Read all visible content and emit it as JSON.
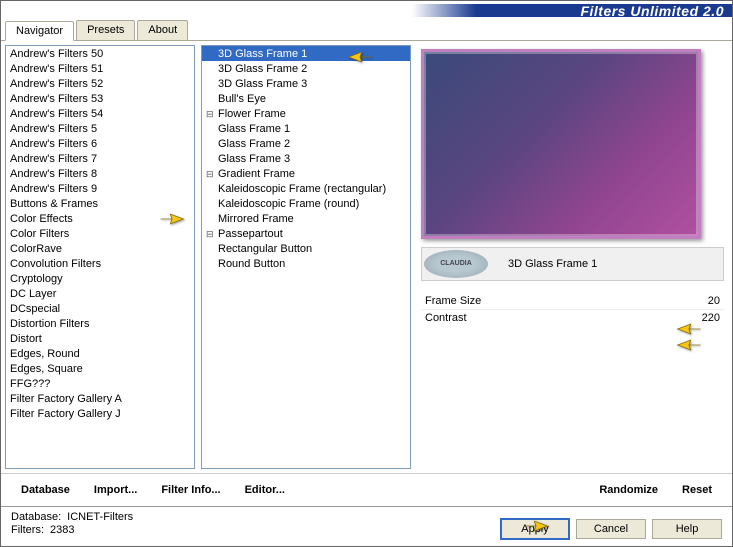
{
  "title": "Filters Unlimited 2.0",
  "tabs": [
    "Navigator",
    "Presets",
    "About"
  ],
  "active_tab": 0,
  "categories": [
    "Andrew's Filters 50",
    "Andrew's Filters 51",
    "Andrew's Filters 52",
    "Andrew's Filters 53",
    "Andrew's Filters 54",
    "Andrew's Filters 5",
    "Andrew's Filters 6",
    "Andrew's Filters 7",
    "Andrew's Filters 8",
    "Andrew's Filters 9",
    "Buttons & Frames",
    "Color Effects",
    "Color Filters",
    "ColorRave",
    "Convolution Filters",
    "Cryptology",
    "DC Layer",
    "DCspecial",
    "Distortion Filters",
    "Distort",
    "Edges, Round",
    "Edges, Square",
    "FFG???",
    "Filter Factory Gallery A",
    "Filter Factory Gallery J"
  ],
  "selected_category": "Buttons & Frames",
  "filters": [
    {
      "label": "3D Glass Frame 1",
      "group": false,
      "selected": true
    },
    {
      "label": "3D Glass Frame 2",
      "group": false
    },
    {
      "label": "3D Glass Frame 3",
      "group": false
    },
    {
      "label": "Bull's Eye",
      "group": false
    },
    {
      "label": "Flower Frame",
      "group": true
    },
    {
      "label": "Glass Frame 1",
      "group": false
    },
    {
      "label": "Glass Frame 2",
      "group": false
    },
    {
      "label": "Glass Frame 3",
      "group": false
    },
    {
      "label": "Gradient Frame",
      "group": true
    },
    {
      "label": "Kaleidoscopic Frame (rectangular)",
      "group": false
    },
    {
      "label": "Kaleidoscopic Frame (round)",
      "group": false
    },
    {
      "label": "Mirrored Frame",
      "group": false
    },
    {
      "label": "Passepartout",
      "group": true
    },
    {
      "label": "Rectangular Button",
      "group": false
    },
    {
      "label": "Round Button",
      "group": false
    }
  ],
  "current_filter": "3D Glass Frame 1",
  "logo_text": "CLAUDIA",
  "params": [
    {
      "name": "Frame Size",
      "value": "20"
    },
    {
      "name": "Contrast",
      "value": "220"
    }
  ],
  "bottom_buttons": {
    "database": "Database",
    "import": "Import...",
    "filter_info": "Filter Info...",
    "editor": "Editor...",
    "randomize": "Randomize",
    "reset": "Reset"
  },
  "status": {
    "db_label": "Database:",
    "db_value": "ICNET-Filters",
    "filters_label": "Filters:",
    "filters_value": "2383"
  },
  "dialog": {
    "apply": "Apply",
    "cancel": "Cancel",
    "help": "Help"
  }
}
